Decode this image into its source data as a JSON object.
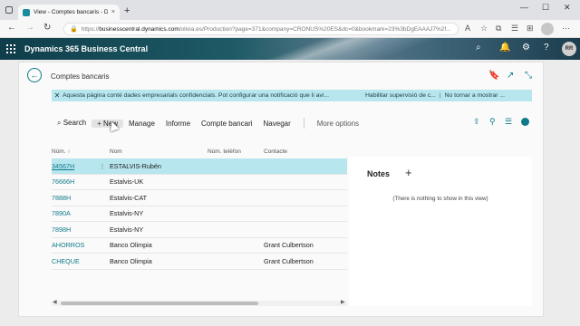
{
  "browser": {
    "tab_title": "View - Comptes bancaris - Dyna",
    "tab_close": "×",
    "new_tab": "+",
    "url_prefix": "https://",
    "url_host": "businesscentral.dynamics.com",
    "url_path": "/olivia.es/Production?page=371&company=CRONUS%20ES&dc=0&bookmark=23%3bDgEAAAJ7%2f..."
  },
  "header": {
    "app_title": "Dynamics 365 Business Central",
    "avatar_initials": "RR"
  },
  "page": {
    "title": "Comptes bancaris"
  },
  "notification": {
    "message": "Aquesta pàgina conté dades empresarials confidencials. Pot configurar una notificació que li avi...",
    "action_enable": "Habilitar supervisió de c...",
    "separator": "|",
    "action_dismiss": "No tornar a mostrar ..."
  },
  "actions": {
    "search": "Search",
    "new": "New",
    "manage": "Manage",
    "report": "Informe",
    "bank_account": "Compte bancari",
    "navigate": "Navegar",
    "more": "More options"
  },
  "table": {
    "headers": {
      "num": "Núm. ↑",
      "nom": "Nom",
      "tel": "Núm. telèfon",
      "contact": "Contacte"
    },
    "rows": [
      {
        "num": "34567H",
        "nom": "ESTALVIS-Rubén",
        "tel": "",
        "contact": ""
      },
      {
        "num": "76666H",
        "nom": "Estalvis-UK",
        "tel": "",
        "contact": ""
      },
      {
        "num": "7888H",
        "nom": "Estalvis-CAT",
        "tel": "",
        "contact": ""
      },
      {
        "num": "7890A",
        "nom": "Estalvis-NY",
        "tel": "",
        "contact": ""
      },
      {
        "num": "7898H",
        "nom": "Estalvis-NY",
        "tel": "",
        "contact": ""
      },
      {
        "num": "AHORROS",
        "nom": "Banco Olimpia",
        "tel": "",
        "contact": "Grant Culbertson"
      },
      {
        "num": "CHEQUE",
        "nom": "Banco Olimpia",
        "tel": "",
        "contact": "Grant Culbertson"
      }
    ]
  },
  "notes": {
    "title": "Notes",
    "empty_text": "(There is nothing to show in this view)"
  },
  "colors": {
    "accent": "#0e7a8a",
    "selection": "#b7e6ee"
  }
}
